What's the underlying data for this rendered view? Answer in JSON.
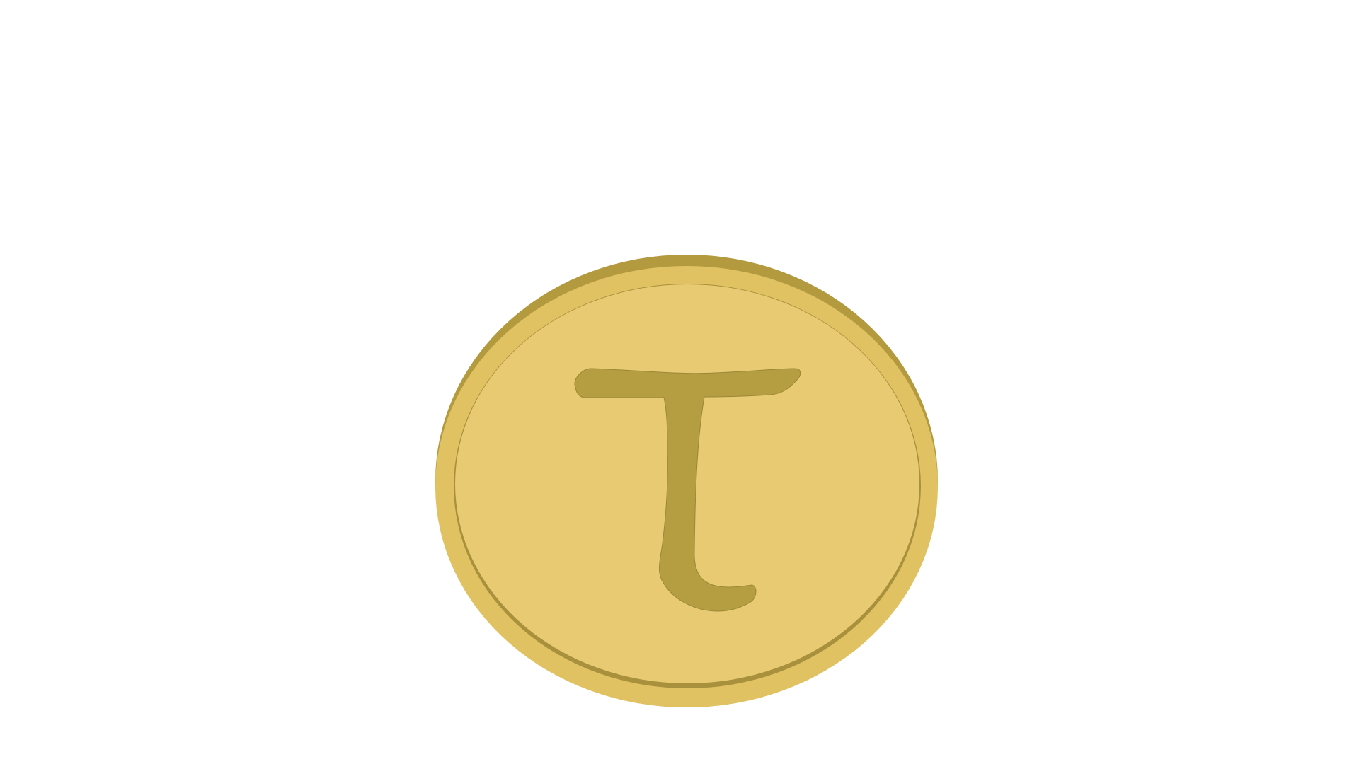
{
  "coin": {
    "glyph": "τ",
    "colors": {
      "background": "#ffffff",
      "rim_dark": "#b39a3f",
      "rim": "#e1c263",
      "face": "#e7ca72",
      "inner_ring": "#a8903c",
      "glyph": "#b59e42"
    },
    "icon": "tau-coin-icon"
  }
}
